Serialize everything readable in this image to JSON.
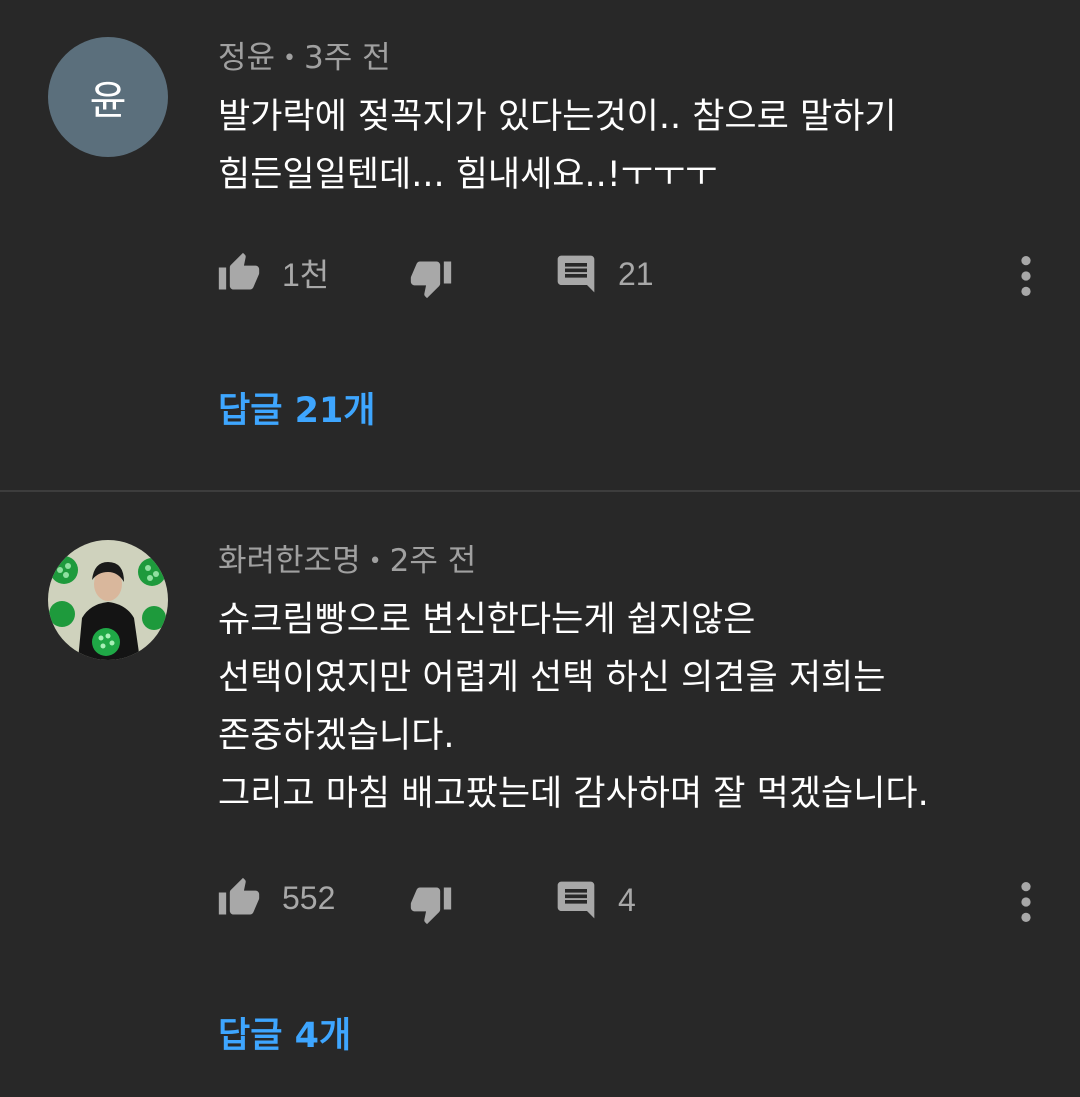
{
  "comments": [
    {
      "avatar_letter": "윤",
      "author": "정윤",
      "separator": "•",
      "time": "3주 전",
      "lines": [
        "발가락에 젖꼭지가 있다는것이.. 참으로 말하기",
        "힘든일일텐데... 힘내세요..!ㅜㅜㅜ"
      ],
      "likes": "1천",
      "reply_count": "21",
      "replies_link": "답글 21개"
    },
    {
      "author": "화려한조명",
      "separator": "•",
      "time": "2주 전",
      "lines": [
        "슈크림빵으로 변신한다는게 쉽지않은",
        "선택이였지만 어렵게 선택 하신 의견을 저희는",
        "존중하겠습니다.",
        "그리고 마침 배고팠는데 감사하며 잘 먹겠습니다."
      ],
      "likes": "552",
      "reply_count": "4",
      "replies_link": "답글 4개"
    }
  ],
  "icons": {
    "like": "thumb-up-icon",
    "dislike": "thumb-down-icon",
    "reply": "comment-icon",
    "more": "more-vertical-icon"
  },
  "colors": {
    "background": "#282828",
    "link": "#3ea6ff",
    "meta_text": "#a0a0a0",
    "avatar_bg": "#5b6f7c"
  }
}
